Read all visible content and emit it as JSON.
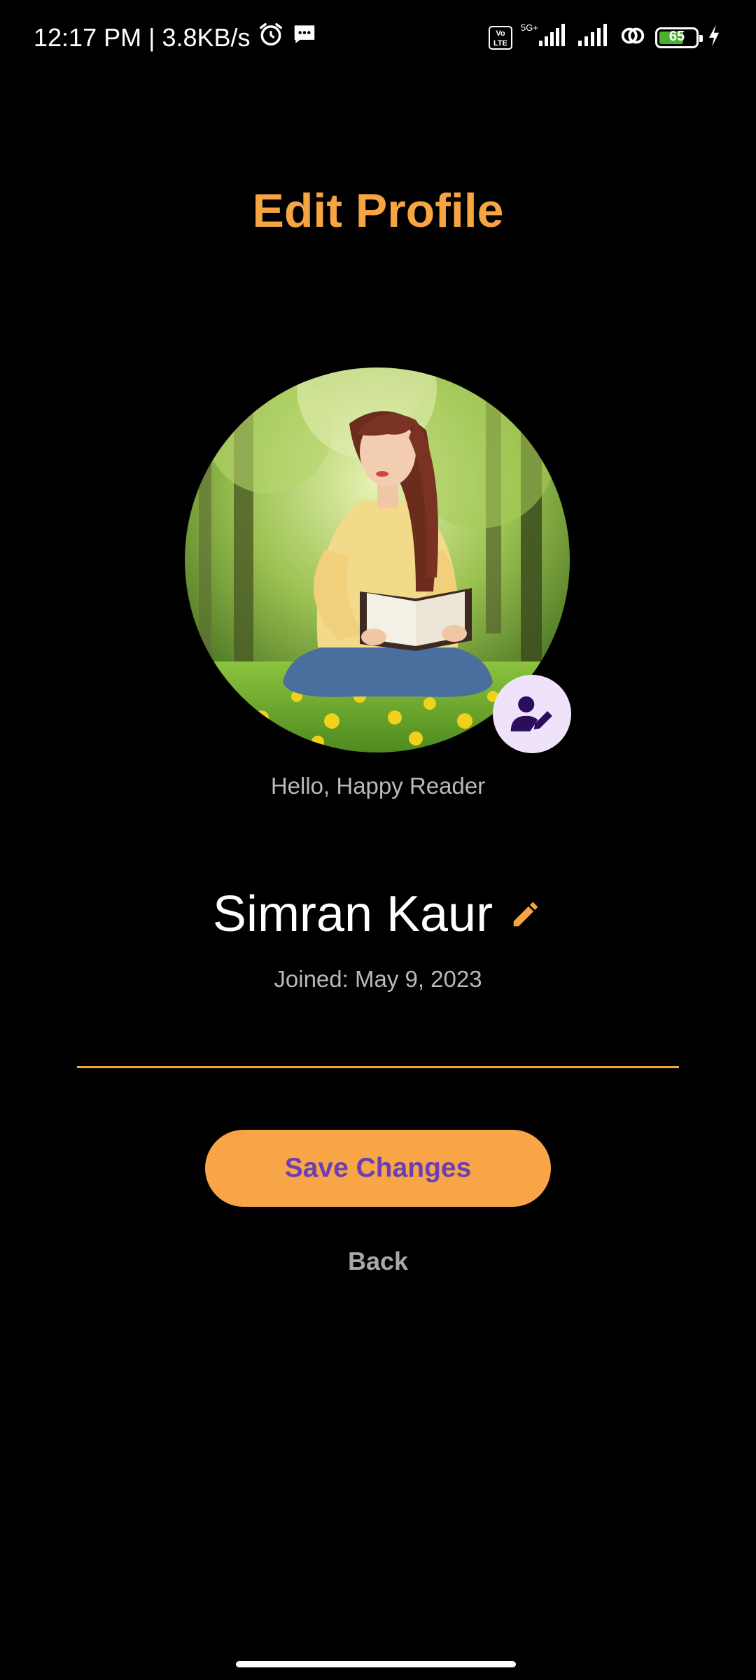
{
  "status_bar": {
    "time_speed": "12:17 PM | 3.8KB/s",
    "network": "5G+",
    "volte": "Vo LTE",
    "battery_level": "65",
    "icons": [
      "alarm-icon",
      "message-icon",
      "signal-icon",
      "hotspot-icon",
      "battery-icon",
      "charging-icon"
    ]
  },
  "header": {
    "title": "Edit Profile"
  },
  "profile": {
    "greeting": "Hello, Happy Reader",
    "name": "Simran Kaur",
    "joined": "Joined: May 9, 2023",
    "photo_edit_icon": "user-edit-icon",
    "name_edit_icon": "pencil-icon"
  },
  "actions": {
    "save_label": "Save Changes",
    "back_label": "Back"
  },
  "colors": {
    "accent": "#f7a542",
    "button_text": "#6b3fb0",
    "background": "#000000",
    "muted_text": "#b9b9b9"
  }
}
